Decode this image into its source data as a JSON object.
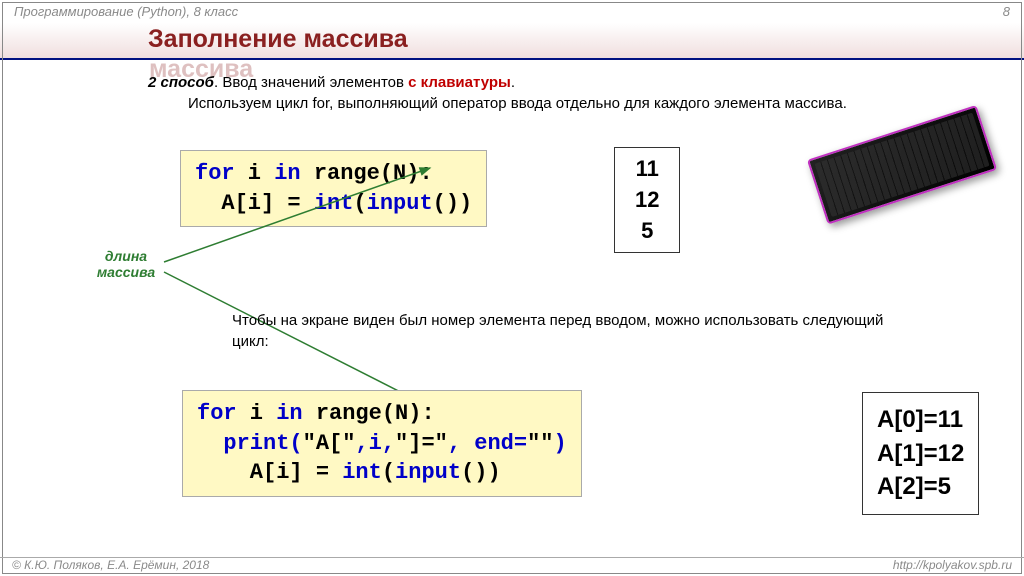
{
  "header": {
    "course": "Программирование (Python), 8 класс",
    "page": "8"
  },
  "title": "Заполнение массива",
  "intro": {
    "method": "2 способ",
    "method_tail": ". Ввод значений элементов ",
    "red_part": "с клавиатуры",
    "method_end": ".",
    "desc": "Используем цикл for, выполняющий оператор ввода отдельно для каждого элемента массива."
  },
  "code1": {
    "l1a": "for",
    "l1b": " i ",
    "l1c": "in",
    "l1d": " range(N):",
    "l2a": "  A[i] = ",
    "l2b": "int",
    "l2c": "(",
    "l2d": "input",
    "l2e": "())"
  },
  "out1": {
    "a": "11",
    "b": "12",
    "c": "5"
  },
  "label_len": "длина массива",
  "desc2": "Чтобы на экране виден был номер элемента перед вводом, можно использовать следующий цикл:",
  "code2": {
    "l1a": "for",
    "l1b": " i ",
    "l1c": "in",
    "l1d": " range(N):",
    "l2a": "  print(",
    "l2b": "\"A[\"",
    "l2c": ",i,",
    "l2d": "\"]=\"",
    "l2e": ", end=",
    "l2f": "\"\"",
    "l2g": ")",
    "l3a": "    A[i] = ",
    "l3b": "int",
    "l3c": "(",
    "l3d": "input",
    "l3e": "())"
  },
  "out2": {
    "a": "A[0]=11",
    "b": "A[1]=12",
    "c": "A[2]=5"
  },
  "footer": {
    "left": "© К.Ю. Поляков, Е.А. Ерёмин, 2018",
    "right": "http://kpolyakov.spb.ru"
  }
}
